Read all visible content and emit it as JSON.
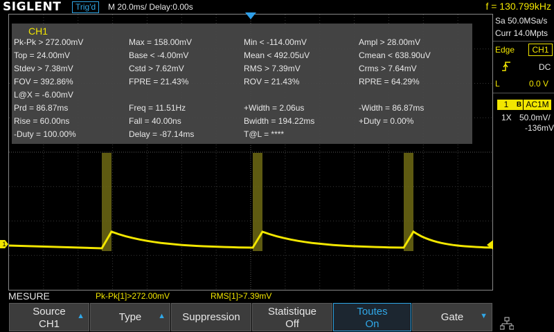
{
  "header": {
    "brand": "SIGLENT",
    "trigger_state": "Trig'd",
    "timebase": "M 20.0ms/ Delay:0.00s",
    "frequency": "f = 130.799kHz"
  },
  "measurements": {
    "channel": "CH1",
    "rows": [
      [
        "Pk-Pk > 272.00mV",
        "Max = 158.00mV",
        "Min < -114.00mV",
        "Ampl > 28.00mV"
      ],
      [
        "Top = 24.00mV",
        "Base < -4.00mV",
        "Mean < 492.05uV",
        "Cmean < 638.90uV"
      ],
      [
        "Stdev > 7.38mV",
        "Cstd > 7.62mV",
        "RMS > 7.39mV",
        "Crms > 7.64mV"
      ],
      [
        "FOV = 392.86%",
        "FPRE = 21.43%",
        "ROV = 21.43%",
        "RPRE = 64.29%"
      ],
      [
        "L@X = -6.00mV",
        "",
        "",
        ""
      ],
      [
        "Prd = 86.87ms",
        "Freq = 11.51Hz",
        "+Width = 2.06us",
        "-Width = 86.87ms"
      ],
      [
        "Rise = 60.00ns",
        "Fall = 40.00ns",
        "Bwidth = 194.22ms",
        "+Duty = 0.00%"
      ],
      [
        "-Duty = 100.00%",
        "Delay = -87.14ms",
        "T@L = ****",
        ""
      ]
    ]
  },
  "right_panel": {
    "sample_rate": "Sa 50.0MSa/s",
    "memory_depth": "Curr 14.0Mpts",
    "trigger_type": "Edge",
    "trigger_source": "CH1",
    "slope_icon": "rising-edge-icon",
    "coupling": "DC",
    "level_label": "L",
    "level_value": "0.0 V",
    "channel_number": "1",
    "bandwidth_badge": "B",
    "channel_coupling": "AC1M",
    "probe": "1X",
    "vdiv": "50.0mV/",
    "offset": "-136mV"
  },
  "status": {
    "mode": "MESURE",
    "stat1": "Pk-Pk[1]>272.00mV",
    "stat2": "RMS[1]>7.39mV"
  },
  "softkeys": [
    {
      "line1": "Source",
      "line2": "CH1",
      "arrow": "up"
    },
    {
      "line1": "Type",
      "line2": "",
      "arrow": "up"
    },
    {
      "line1": "Suppression",
      "line2": "",
      "arrow": ""
    },
    {
      "line1": "Statistique",
      "line2": "Off",
      "arrow": ""
    },
    {
      "line1": "Toutes",
      "line2": "On",
      "arrow": ""
    },
    {
      "line1": "Gate",
      "line2": "",
      "arrow": "down"
    }
  ],
  "markers": {
    "ground_marker": "1"
  },
  "colors": {
    "ch1": "#f2e600",
    "accent": "#30a8e8",
    "panel": "#484848"
  }
}
